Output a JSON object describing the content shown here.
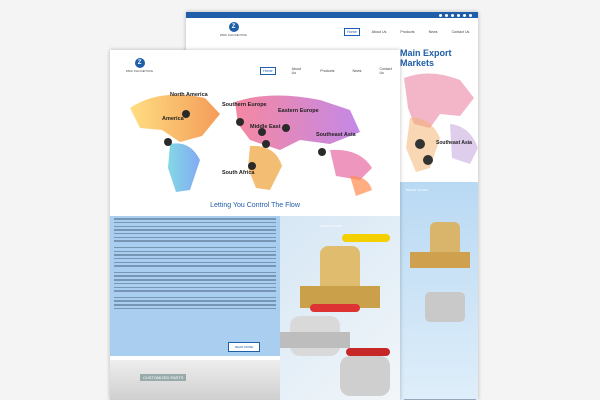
{
  "brand": {
    "mark": "Z",
    "name": "ZMC FAUCETING"
  },
  "nav": {
    "home": "Home",
    "about": "About Us",
    "products": "Products",
    "news": "News",
    "contact": "Contact Us"
  },
  "back_page": {
    "section_title": "Main Export Markets",
    "map_label": "Southeast Asia",
    "photo_caption": "BRASS VALVES"
  },
  "front_page": {
    "map": {
      "labels": [
        "North America",
        "America",
        "Southern Europe",
        "Eastern Europe",
        "Middle East",
        "Southeast Asia",
        "South Africa"
      ]
    },
    "tagline": "Letting You Control The Flow",
    "photo_caption": "BRASS VALVES",
    "read_more": "READ MORE",
    "footer_left": "CUSTOMIZED PARTS"
  },
  "colors": {
    "brand_blue": "#1f5ea8",
    "light_blue": "#a9cef0"
  }
}
